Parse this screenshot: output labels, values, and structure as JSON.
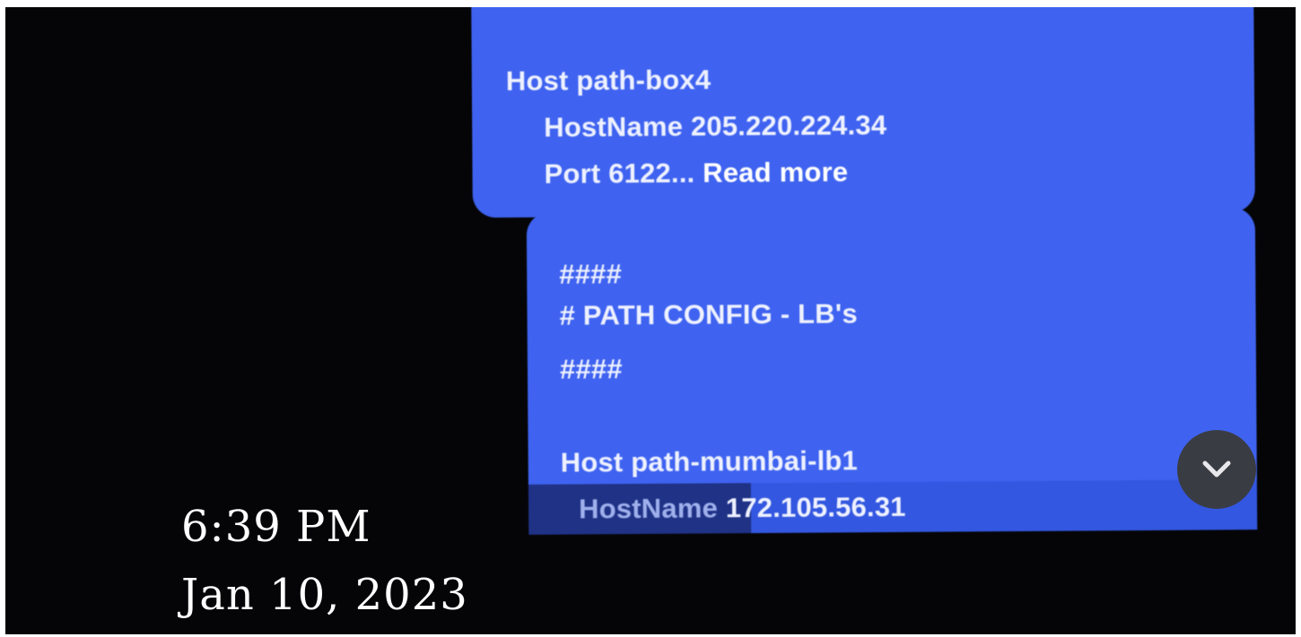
{
  "messages": [
    {
      "line1": "Host path-box4",
      "line2": "HostName 205.220.224.34",
      "line3_prefix": "Port 6122...",
      "read_more": "Read more"
    },
    {
      "line1": "####",
      "line2": "# PATH CONFIG - LB's",
      "line3": "####",
      "line4": "Host path-mumbai-lb1",
      "line5_key": "HostName",
      "line5_value": "172.105.56.31"
    }
  ],
  "scroll_button": {
    "icon": "chevron-down-icon"
  },
  "overlay": {
    "time": "6:39 PM",
    "date": "Jan 10, 2023"
  },
  "colors": {
    "bubble": "#3f63f0",
    "background": "#050508",
    "scroll_button": "#3a3c44"
  }
}
